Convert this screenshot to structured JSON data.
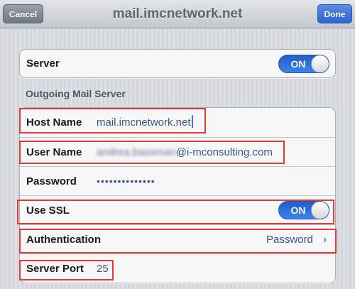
{
  "navbar": {
    "title": "mail.imcnetwork.net",
    "cancel_label": "Cancel",
    "done_label": "Done"
  },
  "server_group": {
    "label": "Server",
    "toggle": "ON"
  },
  "outgoing": {
    "header": "Outgoing Mail Server",
    "host_name": {
      "label": "Host Name",
      "value": "mail.imcnetwork.net"
    },
    "user_name": {
      "label": "User Name",
      "value_hidden": "andrea.bassman",
      "value_visible": "@i-mconsulting.com"
    },
    "password": {
      "label": "Password",
      "value": "••••••••••••••"
    },
    "use_ssl": {
      "label": "Use SSL",
      "toggle": "ON"
    },
    "authentication": {
      "label": "Authentication",
      "value": "Password"
    },
    "server_port": {
      "label": "Server Port",
      "value": "25"
    }
  },
  "colors": {
    "accent": "#2f6fd9",
    "highlight": "#e23c3a",
    "value_text": "#3a5488"
  },
  "icons": {
    "chevron": "chevron-right-icon"
  }
}
